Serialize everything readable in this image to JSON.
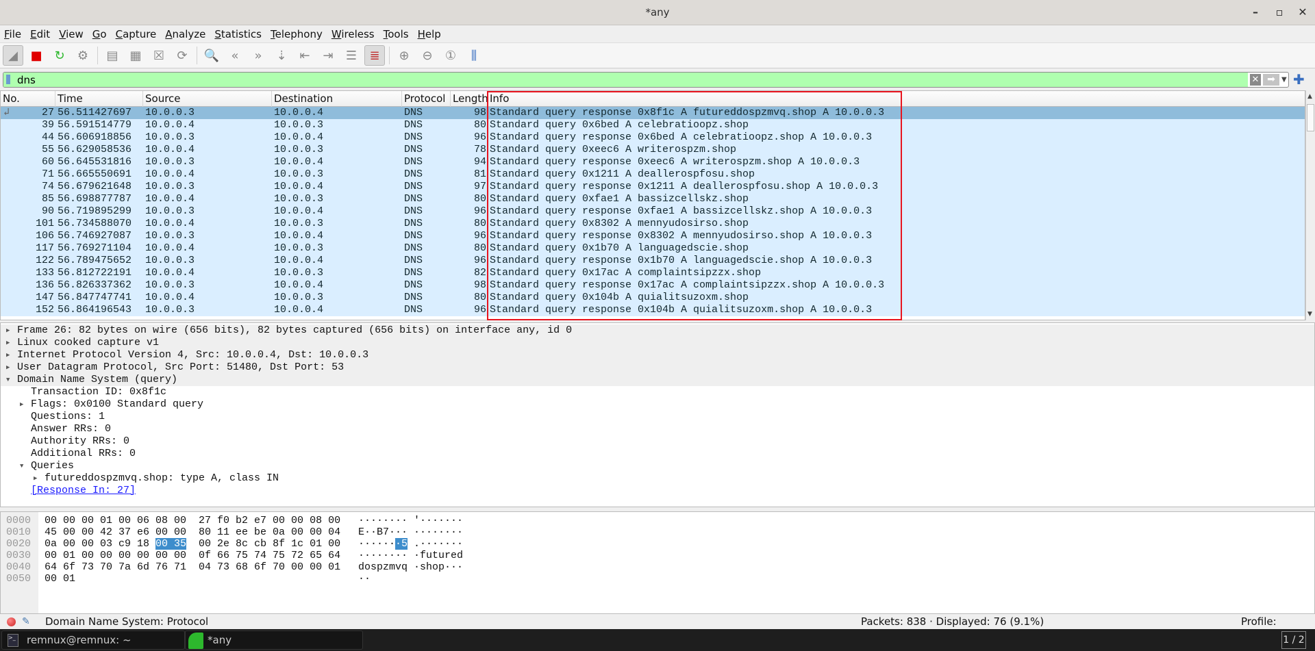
{
  "window": {
    "title": "*any",
    "minimize": "–",
    "maximize": "▫",
    "close": "✕"
  },
  "menu": [
    "File",
    "Edit",
    "View",
    "Go",
    "Capture",
    "Analyze",
    "Statistics",
    "Telephony",
    "Wireless",
    "Tools",
    "Help"
  ],
  "toolbar": [
    {
      "icon": "shark-fin-start-icon",
      "glyph": "◢",
      "on": true
    },
    {
      "icon": "stop-capture-icon",
      "glyph": "■",
      "color": "#e00000"
    },
    {
      "icon": "restart-capture-icon",
      "glyph": "↻",
      "color": "#2db82d"
    },
    {
      "icon": "capture-options-icon",
      "glyph": "⚙"
    },
    {
      "sep": true
    },
    {
      "icon": "open-file-icon",
      "glyph": "▤"
    },
    {
      "icon": "save-file-icon",
      "glyph": "▦"
    },
    {
      "icon": "close-file-icon",
      "glyph": "☒"
    },
    {
      "icon": "reload-file-icon",
      "glyph": "⟳"
    },
    {
      "sep": true
    },
    {
      "icon": "find-packet-icon",
      "glyph": "🔍",
      "color": "#1f4f9f"
    },
    {
      "icon": "go-back-icon",
      "glyph": "«"
    },
    {
      "icon": "go-forward-icon",
      "glyph": "»"
    },
    {
      "icon": "go-to-packet-icon",
      "glyph": "⇣"
    },
    {
      "icon": "first-packet-icon",
      "glyph": "⇤"
    },
    {
      "icon": "last-packet-icon",
      "glyph": "⇥"
    },
    {
      "icon": "autoscroll-icon",
      "glyph": "☰"
    },
    {
      "icon": "colorize-icon",
      "glyph": "≣",
      "on": true,
      "color": "#c03030"
    },
    {
      "sep": true
    },
    {
      "icon": "zoom-in-icon",
      "glyph": "⊕"
    },
    {
      "icon": "zoom-out-icon",
      "glyph": "⊖"
    },
    {
      "icon": "normal-size-icon",
      "glyph": "①"
    },
    {
      "icon": "resize-columns-icon",
      "glyph": "⫼",
      "color": "#3a6fc0"
    }
  ],
  "filter": {
    "value": "dns",
    "bg": "#afffaf"
  },
  "columns": [
    "No.",
    "Time",
    "Source",
    "Destination",
    "Protocol",
    "Length",
    "Info"
  ],
  "packets": [
    [
      "27",
      "56.511427697",
      "10.0.0.3",
      "10.0.0.4",
      "DNS",
      "98",
      "Standard query response 0x8f1c A futureddospzmvq.shop A 10.0.0.3"
    ],
    [
      "39",
      "56.591514779",
      "10.0.0.4",
      "10.0.0.3",
      "DNS",
      "80",
      "Standard query 0x6bed A celebratioopz.shop"
    ],
    [
      "44",
      "56.606918856",
      "10.0.0.3",
      "10.0.0.4",
      "DNS",
      "96",
      "Standard query response 0x6bed A celebratioopz.shop A 10.0.0.3"
    ],
    [
      "55",
      "56.629058536",
      "10.0.0.4",
      "10.0.0.3",
      "DNS",
      "78",
      "Standard query 0xeec6 A writerospzm.shop"
    ],
    [
      "60",
      "56.645531816",
      "10.0.0.3",
      "10.0.0.4",
      "DNS",
      "94",
      "Standard query response 0xeec6 A writerospzm.shop A 10.0.0.3"
    ],
    [
      "71",
      "56.665550691",
      "10.0.0.4",
      "10.0.0.3",
      "DNS",
      "81",
      "Standard query 0x1211 A deallerospfosu.shop"
    ],
    [
      "74",
      "56.679621648",
      "10.0.0.3",
      "10.0.0.4",
      "DNS",
      "97",
      "Standard query response 0x1211 A deallerospfosu.shop A 10.0.0.3"
    ],
    [
      "85",
      "56.698877787",
      "10.0.0.4",
      "10.0.0.3",
      "DNS",
      "80",
      "Standard query 0xfae1 A bassizcellskz.shop"
    ],
    [
      "90",
      "56.719895299",
      "10.0.0.3",
      "10.0.0.4",
      "DNS",
      "96",
      "Standard query response 0xfae1 A bassizcellskz.shop A 10.0.0.3"
    ],
    [
      "101",
      "56.734588070",
      "10.0.0.4",
      "10.0.0.3",
      "DNS",
      "80",
      "Standard query 0x8302 A mennyudosirso.shop"
    ],
    [
      "106",
      "56.746927087",
      "10.0.0.3",
      "10.0.0.4",
      "DNS",
      "96",
      "Standard query response 0x8302 A mennyudosirso.shop A 10.0.0.3"
    ],
    [
      "117",
      "56.769271104",
      "10.0.0.4",
      "10.0.0.3",
      "DNS",
      "80",
      "Standard query 0x1b70 A languagedscie.shop"
    ],
    [
      "122",
      "56.789475652",
      "10.0.0.3",
      "10.0.0.4",
      "DNS",
      "96",
      "Standard query response 0x1b70 A languagedscie.shop A 10.0.0.3"
    ],
    [
      "133",
      "56.812722191",
      "10.0.0.4",
      "10.0.0.3",
      "DNS",
      "82",
      "Standard query 0x17ac A complaintsipzzx.shop"
    ],
    [
      "136",
      "56.826337362",
      "10.0.0.3",
      "10.0.0.4",
      "DNS",
      "98",
      "Standard query response 0x17ac A complaintsipzzx.shop A 10.0.0.3"
    ],
    [
      "147",
      "56.847747741",
      "10.0.0.4",
      "10.0.0.3",
      "DNS",
      "80",
      "Standard query 0x104b A quialitsuzoxm.shop"
    ],
    [
      "152",
      "56.864196543",
      "10.0.0.3",
      "10.0.0.4",
      "DNS",
      "96",
      "Standard query response 0x104b A quialitsuzoxm.shop A 10.0.0.3"
    ]
  ],
  "colors": {
    "selected_row": "#8fbcdb",
    "dns_row": "#daeeff",
    "highlight_box": "#e8141e"
  },
  "details": [
    {
      "text": "Frame 26: 82 bytes on wire (656 bits), 82 bytes captured (656 bits) on interface any, id 0",
      "level": 0,
      "arrow": "right",
      "top": true
    },
    {
      "text": "Linux cooked capture v1",
      "level": 0,
      "arrow": "right",
      "top": true
    },
    {
      "text": "Internet Protocol Version 4, Src: 10.0.0.4, Dst: 10.0.0.3",
      "level": 0,
      "arrow": "right",
      "top": true
    },
    {
      "text": "User Datagram Protocol, Src Port: 51480, Dst Port: 53",
      "level": 0,
      "arrow": "right",
      "top": true
    },
    {
      "text": "Domain Name System (query)",
      "level": 0,
      "arrow": "down",
      "top": true
    },
    {
      "text": "Transaction ID: 0x8f1c",
      "level": 1
    },
    {
      "text": "Flags: 0x0100 Standard query",
      "level": 1,
      "arrow": "right"
    },
    {
      "text": "Questions: 1",
      "level": 1
    },
    {
      "text": "Answer RRs: 0",
      "level": 1
    },
    {
      "text": "Authority RRs: 0",
      "level": 1
    },
    {
      "text": "Additional RRs: 0",
      "level": 1
    },
    {
      "text": "Queries",
      "level": 1,
      "arrow": "down"
    },
    {
      "text": "futureddospzmvq.shop: type A, class IN",
      "level": 2,
      "arrow": "right"
    },
    {
      "text": "[Response In: 27]",
      "level": 1,
      "link": true
    }
  ],
  "hex": [
    {
      "off": "0000",
      "pre": "00 00 00 01 00 06 08 00  27 f0 b2 e7 00 00 08 00",
      "asc": "········ '·······"
    },
    {
      "off": "0010",
      "pre": "45 00 00 42 37 e6 00 00  80 11 ee be 0a 00 00 04",
      "asc": "E··B7··· ········"
    },
    {
      "off": "0020",
      "pre": "0a 00 00 03 c9 18 ",
      "hl": "00 35",
      "post": "  00 2e 8c cb 8f 1c 01 00",
      "asc_pre": "······",
      "asc_hl": "·5",
      "asc_post": " .·······"
    },
    {
      "off": "0030",
      "pre": "00 01 00 00 00 00 00 00  0f 66 75 74 75 72 65 64",
      "asc": "········ ·futured"
    },
    {
      "off": "0040",
      "pre": "64 6f 73 70 7a 6d 76 71  04 73 68 6f 70 00 00 01",
      "asc": "dospzmvq ·shop···"
    },
    {
      "off": "0050",
      "pre": "00 01",
      "asc": "··"
    }
  ],
  "status": {
    "field": "Domain Name System: Protocol",
    "packets": "Packets: 838 · Displayed: 76 (9.1%)",
    "profile": "Profile: Default"
  },
  "taskbar": {
    "terminal": "remnux@remnux: ~",
    "wireshark": "*any",
    "workspace": "1 / 2"
  }
}
